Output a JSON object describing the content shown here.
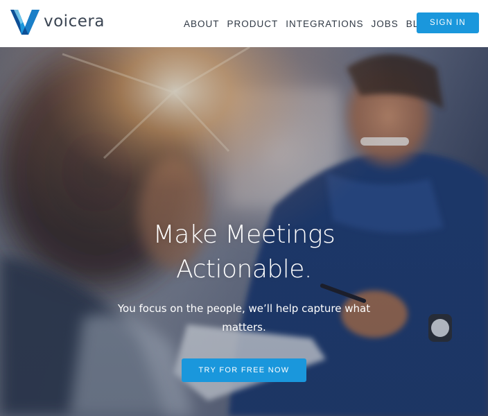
{
  "brand": {
    "name": "voicera",
    "mark_colors": [
      "#0d4f96",
      "#1a97dc",
      "#7fd0f0"
    ]
  },
  "nav": {
    "items": [
      {
        "label": "ABOUT"
      },
      {
        "label": "PRODUCT"
      },
      {
        "label": "INTEGRATIONS"
      },
      {
        "label": "JOBS"
      },
      {
        "label": "BLOG"
      }
    ],
    "signin_label": "SIGN IN"
  },
  "hero": {
    "title_line1": "Make Meetings",
    "title_line2": "Actionable.",
    "subtitle_line1": "You focus on the people, we’ll help capture what",
    "subtitle_line2": "matters.",
    "cta_label": "TRY FOR FREE NOW",
    "image_description_icon": "photo-background"
  },
  "colors": {
    "accent": "#1a97dc",
    "nav_text": "#2f3844",
    "header_bg": "#ffffff"
  }
}
